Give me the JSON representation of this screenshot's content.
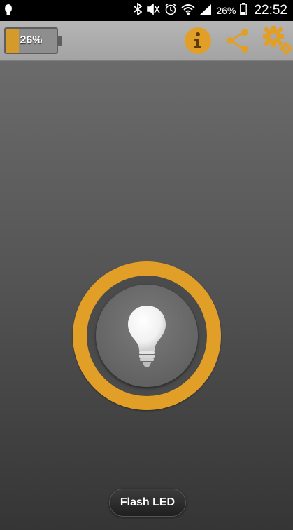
{
  "status_bar": {
    "signal_percent": "26%",
    "clock": "22:52",
    "icons": [
      "bulb-icon",
      "bluetooth-icon",
      "mute-icon",
      "alarm-icon",
      "wifi-icon",
      "cellular-signal-icon",
      "battery-icon"
    ]
  },
  "app_bar": {
    "battery_label": "26%",
    "battery_level": 0.26,
    "actions": [
      "info-icon",
      "share-icon",
      "settings-icon"
    ]
  },
  "main": {
    "power_button_icon": "light-bulb-icon",
    "flash_button_label": "Flash LED"
  },
  "colors": {
    "accent": "#E29F28",
    "app_bar": "#ADADAD",
    "background_top": "#6B6B6B",
    "background_bottom": "#353535"
  }
}
